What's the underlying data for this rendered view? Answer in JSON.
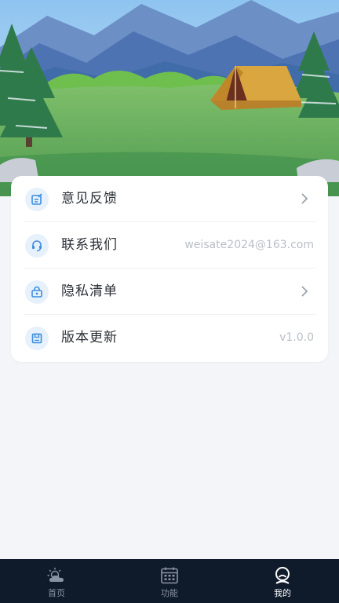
{
  "menu": {
    "items": [
      {
        "label": "意见反馈",
        "value": "",
        "icon": "feedback-edit-icon",
        "has_chevron": true
      },
      {
        "label": "联系我们",
        "value": "weisate2024@163.com",
        "icon": "headset-icon",
        "has_chevron": false
      },
      {
        "label": "隐私清单",
        "value": "",
        "icon": "privacy-lock-icon",
        "has_chevron": true
      },
      {
        "label": "版本更新",
        "value": "v1.0.0",
        "icon": "save-disk-icon",
        "has_chevron": false
      }
    ]
  },
  "tabbar": {
    "tabs": [
      {
        "label": "首页",
        "icon": "weather-cloud-sun-icon",
        "active": false
      },
      {
        "label": "功能",
        "icon": "calendar-icon",
        "active": false
      },
      {
        "label": "我的",
        "icon": "user-profile-icon",
        "active": true
      }
    ]
  },
  "colors": {
    "accent": "#3a8de0",
    "tabbar_bg": "#0f1a2b",
    "page_bg": "#f3f5f9"
  }
}
